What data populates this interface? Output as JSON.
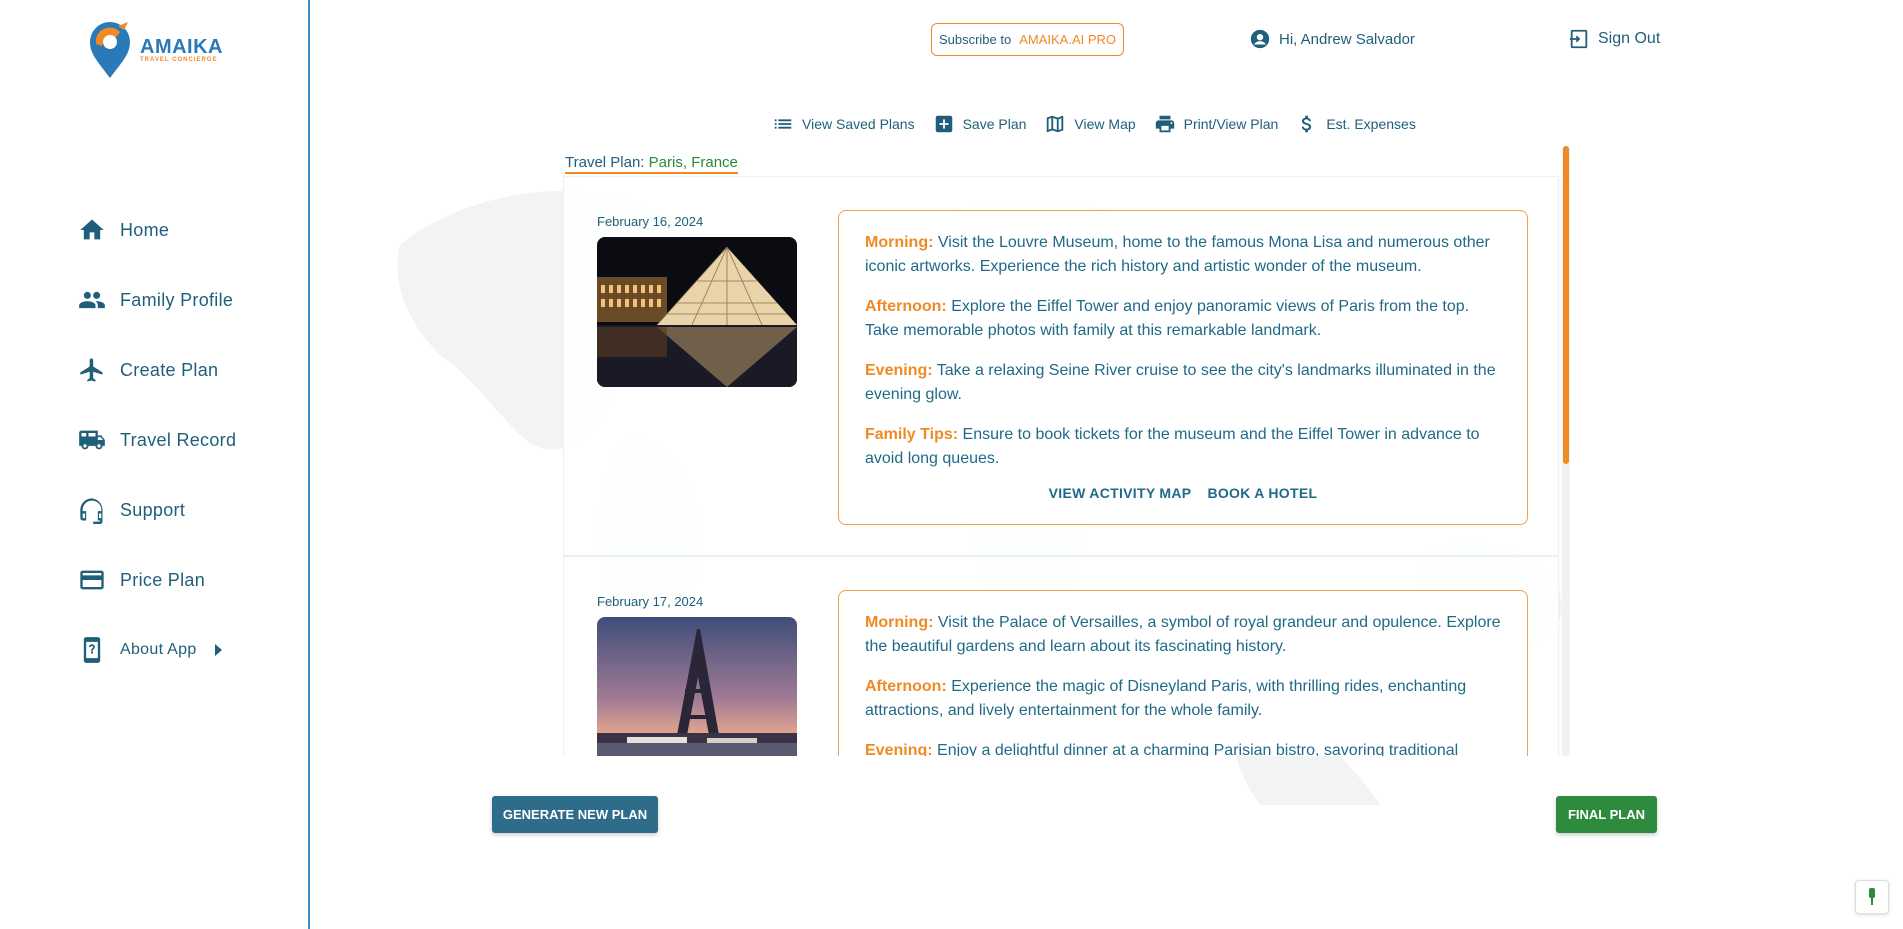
{
  "brand": {
    "name": "AMAIKA",
    "tagline": "TRAVEL CONCIERGE"
  },
  "sidebar": {
    "items": [
      {
        "label": "Home",
        "icon": "home-icon"
      },
      {
        "label": "Family Profile",
        "icon": "people-icon"
      },
      {
        "label": "Create Plan",
        "icon": "airplane-icon"
      },
      {
        "label": "Travel Record",
        "icon": "bus-icon"
      },
      {
        "label": "Support",
        "icon": "headset-icon"
      },
      {
        "label": "Price Plan",
        "icon": "credit-card-icon"
      },
      {
        "label": "About App",
        "icon": "phone-help-icon"
      }
    ]
  },
  "header": {
    "subscribe_prefix": "Subscribe to",
    "subscribe_brand": "AMAIKA.AI PRO",
    "greeting": "Hi, Andrew Salvador",
    "signout": "Sign Out"
  },
  "toolbar": {
    "view_saved": "View Saved Plans",
    "save": "Save Plan",
    "view_map": "View Map",
    "print": "Print/View Plan",
    "expenses": "Est. Expenses"
  },
  "plan": {
    "title_prefix": "Travel Plan: ",
    "city": "Paris",
    "separator": ", ",
    "country": "France"
  },
  "days": [
    {
      "date": "February 16, 2024",
      "photo": "louvre-pyramid-night",
      "morning_label": "Morning:",
      "morning": "Visit the Louvre Museum, home to the famous Mona Lisa and numerous other iconic artworks. Experience the rich history and artistic wonder of the museum.",
      "afternoon_label": "Afternoon:",
      "afternoon": "Explore the Eiffel Tower and enjoy panoramic views of Paris from the top. Take memorable photos with family at this remarkable landmark.",
      "evening_label": "Evening:",
      "evening": "Take a relaxing Seine River cruise to see the city's landmarks illuminated in the evening glow.",
      "tips_label": "Family Tips:",
      "tips": "Ensure to book tickets for the museum and the Eiffel Tower in advance to avoid long queues.",
      "link_map": "VIEW ACTIVITY MAP",
      "link_hotel": "BOOK A HOTEL"
    },
    {
      "date": "February 17, 2024",
      "photo": "eiffel-tower-dusk",
      "morning_label": "Morning:",
      "morning": "Visit the Palace of Versailles, a symbol of royal grandeur and opulence. Explore the beautiful gardens and learn about its fascinating history.",
      "afternoon_label": "Afternoon:",
      "afternoon": "Experience the magic of Disneyland Paris, with thrilling rides, enchanting attractions, and lively entertainment for the whole family.",
      "evening_label": "Evening:",
      "evening": "Enjoy a delightful dinner at a charming Parisian bistro, savoring traditional"
    }
  ],
  "buttons": {
    "generate": "GENERATE NEW PLAN",
    "final": "FINAL PLAN"
  },
  "colors": {
    "primary": "#1f5f7a",
    "accent": "#f08a24",
    "generate_bg": "#2e6c8a",
    "final_bg": "#2e8b3d",
    "sidebar_border": "#3b8fc7"
  }
}
